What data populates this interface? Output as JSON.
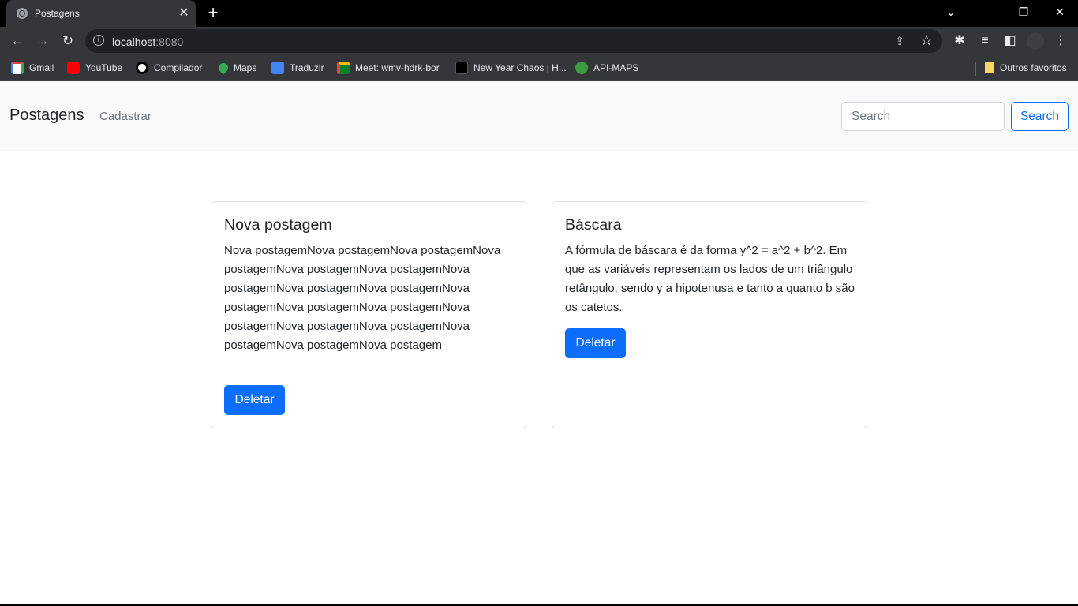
{
  "browser": {
    "tab": {
      "title": "Postagens",
      "favicon": "globe-icon"
    },
    "url": {
      "host": "localhost",
      "port": ":8080"
    },
    "bookmarks": [
      {
        "label": "Gmail",
        "icon": "gmail-icon"
      },
      {
        "label": "YouTube",
        "icon": "youtube-icon"
      },
      {
        "label": "Compilador",
        "icon": "compilador-icon"
      },
      {
        "label": "Maps",
        "icon": "maps-icon"
      },
      {
        "label": "Traduzir",
        "icon": "translate-icon"
      },
      {
        "label": "Meet: wmv-hdrk-bor",
        "icon": "meet-icon"
      },
      {
        "label": "New Year Chaos | H...",
        "icon": "newyear-icon"
      },
      {
        "label": "API-MAPS",
        "icon": "api-maps-icon"
      }
    ],
    "other_bookmarks": "Outros favoritos"
  },
  "navbar": {
    "brand": "Postagens",
    "link": "Cadastrar",
    "search_placeholder": "Search",
    "search_button": "Search"
  },
  "posts": [
    {
      "title": "Nova postagem",
      "body": "Nova postagemNova postagemNova postagemNova postagemNova postagemNova postagemNova postagemNova postagemNova postagemNova postagemNova postagemNova postagemNova postagemNova postagemNova postagemNova postagemNova postagemNova postagem",
      "delete_label": "Deletar"
    },
    {
      "title": "Báscara",
      "body": "A fórmula de báscara é da forma y^2 = a^2 + b^2. Em que as variáveis representam os lados de um triângulo retângulo, sendo y a hipotenusa e tanto a quanto b são os catetos.",
      "delete_label": "Deletar"
    }
  ],
  "colors": {
    "primary": "#0d6efd",
    "navbar_bg": "#f8f9fa",
    "chrome_bg": "#35363a"
  }
}
